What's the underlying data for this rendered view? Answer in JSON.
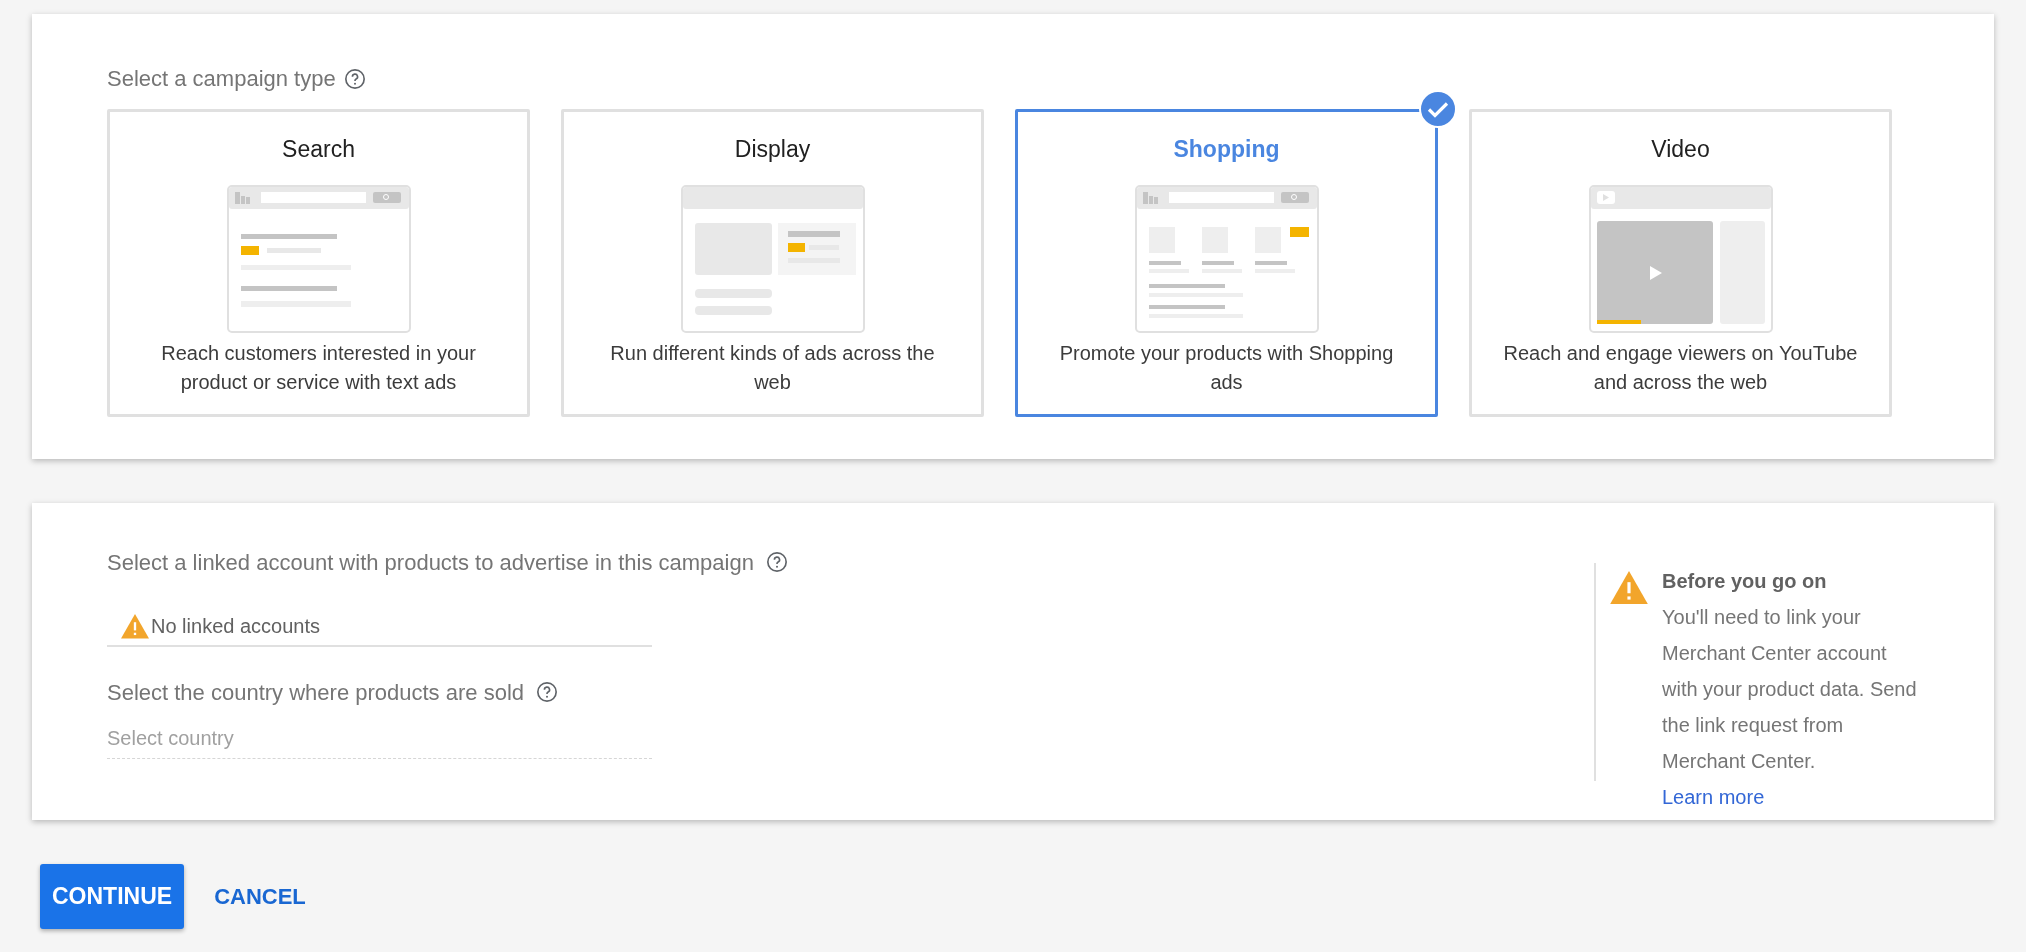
{
  "campaign_type": {
    "label": "Select a campaign type",
    "cards": [
      {
        "kind": "search",
        "title": "Search",
        "description": "Reach customers interested in your product or service with text ads",
        "selected": false
      },
      {
        "kind": "display",
        "title": "Display",
        "description": "Run different kinds of ads across the web",
        "selected": false
      },
      {
        "kind": "shopping",
        "title": "Shopping",
        "description": "Promote your products with Shopping ads",
        "selected": true
      },
      {
        "kind": "video",
        "title": "Video",
        "description": "Reach and engage viewers on YouTube and across the web",
        "selected": false
      }
    ]
  },
  "settings": {
    "account": {
      "label": "Select a linked account with products to advertise in this campaign",
      "value": "No linked accounts"
    },
    "country": {
      "label": "Select the country where products are sold",
      "placeholder": "Select country"
    },
    "notice": {
      "title": "Before you go on",
      "body": "You'll need to link your Merchant Center account with your product data. Send the link request from Merchant Center.",
      "link": "Learn more"
    }
  },
  "buttons": {
    "primary": "CONTINUE",
    "secondary": "CANCEL"
  }
}
